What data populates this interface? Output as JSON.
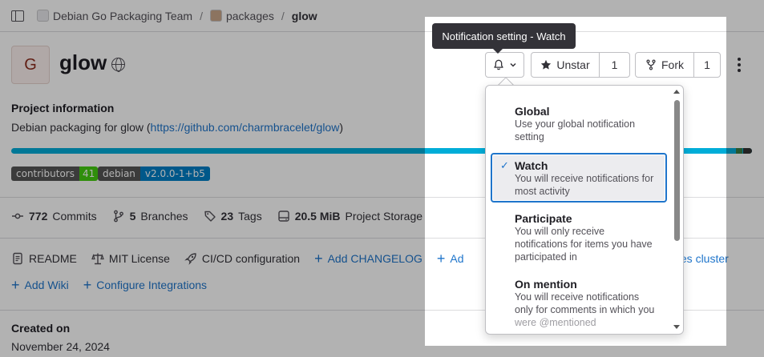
{
  "breadcrumb": {
    "group": "Debian Go Packaging Team",
    "subgroup": "packages",
    "project": "glow"
  },
  "project": {
    "avatar_letter": "G",
    "name": "glow",
    "visibility_icon": "globe-icon",
    "info_heading": "Project information",
    "description_prefix": "Debian packaging for glow (",
    "description_link": "https://github.com/charmbracelet/glow",
    "description_suffix": ")"
  },
  "actions": {
    "notification_icon": "bell-icon",
    "unstar_label": "Unstar",
    "star_count": "1",
    "fork_label": "Fork",
    "fork_count": "1"
  },
  "badges": [
    {
      "key": "contributors",
      "value": "41",
      "color": "#44cc11"
    },
    {
      "key": "debian",
      "value": "v2.0.0-1+b5",
      "color": "#007ec6"
    }
  ],
  "stats": {
    "commits_count": "772",
    "commits_label": "Commits",
    "branches_count": "5",
    "branches_label": "Branches",
    "tags_count": "23",
    "tags_label": "Tags",
    "storage_size": "20.5 MiB",
    "storage_label": "Project Storage"
  },
  "quick_links": {
    "readme": "README",
    "license": "MIT License",
    "cicd": "CI/CD configuration",
    "add_changelog": "Add CHANGELOG",
    "add_partial": "Ad",
    "kubernetes_partial": "tes cluster",
    "add_wiki": "Add Wiki",
    "configure_integrations": "Configure Integrations"
  },
  "created": {
    "label": "Created on",
    "date": "November 24, 2024"
  },
  "tooltip": "Notification setting - Watch",
  "notification_menu": {
    "items": [
      {
        "title": "Global",
        "desc1": "Use your global notification",
        "desc2": "setting",
        "selected": false
      },
      {
        "title": "Watch",
        "desc1": "You will receive notifications for",
        "desc2": "most activity",
        "selected": true
      },
      {
        "title": "Participate",
        "desc1": "You will only receive",
        "desc2": "notifications for items you have",
        "desc3": "participated in",
        "selected": false
      },
      {
        "title": "On mention",
        "desc1": "You will receive notifications",
        "desc2": "only for comments in which you",
        "desc3": "were @mentioned",
        "selected": false
      }
    ]
  },
  "colors": {
    "link": "#1f75cb",
    "language_primary": "#00add8",
    "selected_border": "#1f75cb"
  }
}
